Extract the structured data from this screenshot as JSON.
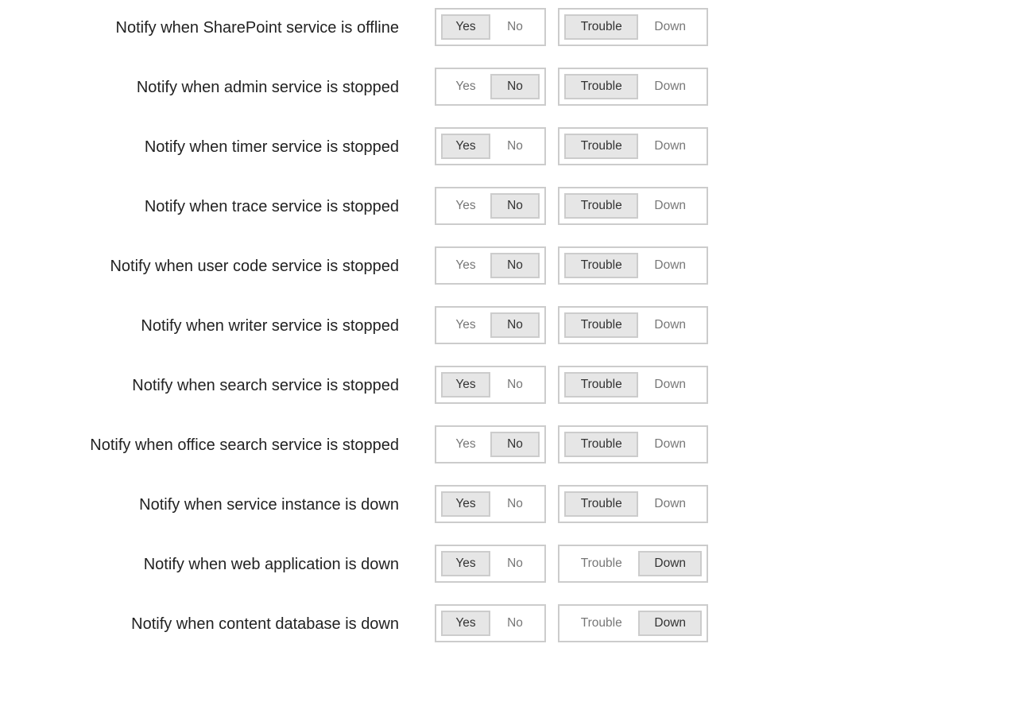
{
  "colors": {
    "border": "#cccccc",
    "selected_fill": "#e6e6e6",
    "selected_text": "#333333",
    "unselected_text": "#777777",
    "label_text": "#222222"
  },
  "options": {
    "yes": "Yes",
    "no": "No",
    "trouble": "Trouble",
    "down": "Down"
  },
  "rows": [
    {
      "label": "Notify when SharePoint service is offline",
      "notify": "Yes",
      "severity": "Trouble"
    },
    {
      "label": "Notify when admin service is stopped",
      "notify": "No",
      "severity": "Trouble"
    },
    {
      "label": "Notify when timer service is stopped",
      "notify": "Yes",
      "severity": "Trouble"
    },
    {
      "label": "Notify when trace service is stopped",
      "notify": "No",
      "severity": "Trouble"
    },
    {
      "label": "Notify when user code service is stopped",
      "notify": "No",
      "severity": "Trouble"
    },
    {
      "label": "Notify when writer service is stopped",
      "notify": "No",
      "severity": "Trouble"
    },
    {
      "label": "Notify when search service is stopped",
      "notify": "Yes",
      "severity": "Trouble"
    },
    {
      "label": "Notify when office search service is stopped",
      "notify": "No",
      "severity": "Trouble"
    },
    {
      "label": "Notify when service instance is down",
      "notify": "Yes",
      "severity": "Trouble"
    },
    {
      "label": "Notify when web application is down",
      "notify": "Yes",
      "severity": "Down"
    },
    {
      "label": "Notify when content database is down",
      "notify": "Yes",
      "severity": "Down"
    }
  ]
}
